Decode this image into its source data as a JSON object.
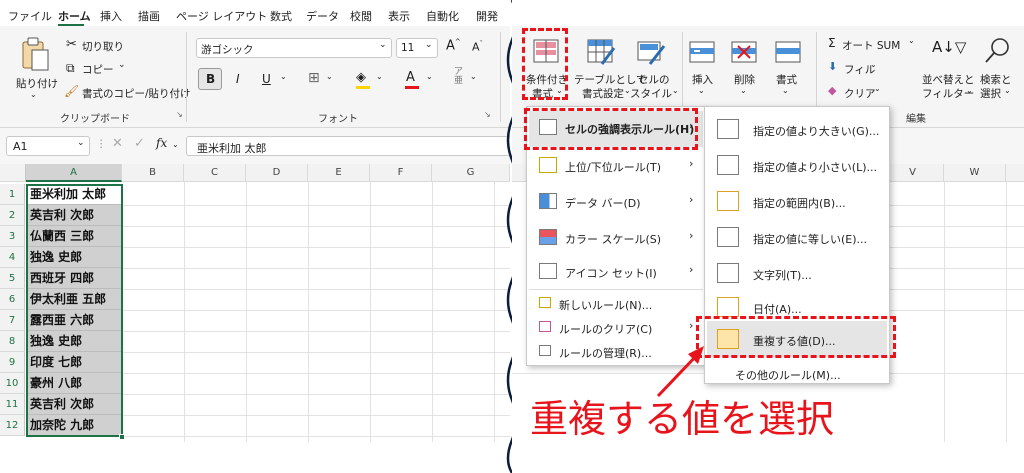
{
  "menu_tabs": [
    "ファイル",
    "ホーム",
    "挿入",
    "描画",
    "ページ レイアウト",
    "数式",
    "データ",
    "校閲",
    "表示",
    "自動化",
    "開発"
  ],
  "clipboard": {
    "paste": "貼り付け",
    "cut": "切り取り",
    "copy": "コピー",
    "format_painter": "書式のコピー/貼り付け",
    "group": "クリップボード"
  },
  "font": {
    "name": "游ゴシック",
    "size": "11",
    "bold": "B",
    "italic": "I",
    "underline": "U",
    "color_letter": "A",
    "group": "フォント"
  },
  "formula_bar": {
    "name_box": "A1",
    "fx": "fx",
    "value": "亜米利加 太郎"
  },
  "columns_left": [
    "A",
    "B",
    "C",
    "D",
    "E",
    "F",
    "G"
  ],
  "rows": [
    {
      "num": "1",
      "a": "亜米利加 太郎"
    },
    {
      "num": "2",
      "a": "英吉利 次郎"
    },
    {
      "num": "3",
      "a": "仏蘭西 三郎"
    },
    {
      "num": "4",
      "a": "独逸 史郎"
    },
    {
      "num": "5",
      "a": "西班牙 四郎"
    },
    {
      "num": "6",
      "a": "伊太利亜 五郎"
    },
    {
      "num": "7",
      "a": "露西亜 六郎"
    },
    {
      "num": "8",
      "a": "独逸 史郎"
    },
    {
      "num": "9",
      "a": "印度 七郎"
    },
    {
      "num": "10",
      "a": "豪州 八郎"
    },
    {
      "num": "11",
      "a": "英吉利 次郎"
    },
    {
      "num": "12",
      "a": "加奈陀 九郎"
    }
  ],
  "ribbon_right": {
    "cond_format_line1": "条件付き",
    "cond_format_line2": "書式",
    "table_line1": "テーブルとして",
    "table_line2": "書式設定",
    "cell_style_line1": "セルの",
    "cell_style_line2": "スタイル",
    "insert": "挿入",
    "delete": "削除",
    "format": "書式",
    "autosum": "オート SUM",
    "fill": "フィル",
    "clear": "クリア",
    "sort_line1": "並べ替えと",
    "sort_line2": "フィルター",
    "find_line1": "検索と",
    "find_line2": "選択",
    "edit_group": "編集"
  },
  "columns_right": [
    "V",
    "W"
  ],
  "cf_menu": [
    "セルの強調表示ルール(H)",
    "上位/下位ルール(T)",
    "データ バー(D)",
    "カラー スケール(S)",
    "アイコン セット(I)",
    "新しいルール(N)...",
    "ルールのクリア(C)",
    "ルールの管理(R)..."
  ],
  "highlight_submenu": [
    "指定の値より大きい(G)...",
    "指定の値より小さい(L)...",
    "指定の範囲内(B)...",
    "指定の値に等しい(E)...",
    "文字列(T)...",
    "日付(A)...",
    "重複する値(D)...",
    "その他のルール(M)..."
  ],
  "annotation": "重複する値を選択",
  "colors": {
    "accent_red": "#e8141c",
    "excel_green": "#1e7145",
    "selection_gray": "#d0d0d0"
  }
}
